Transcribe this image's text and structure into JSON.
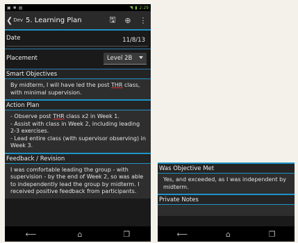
{
  "status_time": "2:29",
  "app": {
    "back_label": "Dev",
    "title": "5. Learning Plan"
  },
  "form": {
    "date_label": "Date",
    "date_value": "11/8/13",
    "placement_label": "Placement",
    "placement_value": "Level 2B",
    "smart_objectives_label": "Smart Objectives",
    "smart_objectives_text": "By midterm, I will have led the post THR class, with minimal supervision.",
    "action_plan_label": "Action Plan",
    "action_plan_lines": [
      "- Observe post THR class x2 in Week 1.",
      "- Assist with class in Week 2, including leading 2-3 exercises.",
      "- Lead entire class (with supervisor observing) in Week 3."
    ],
    "feedback_label": "Feedback / Revision",
    "feedback_text": "I was comfortable leading the group - with supervision - by the end of Week 2, so was able to independently lead the group by midterm. I received positive feedback from participants."
  },
  "form2": {
    "objective_met_label": "Was Objective Met",
    "objective_met_text": "Yes, and exceeded, as I was independent by midterm.",
    "private_notes_label": "Private Notes"
  }
}
